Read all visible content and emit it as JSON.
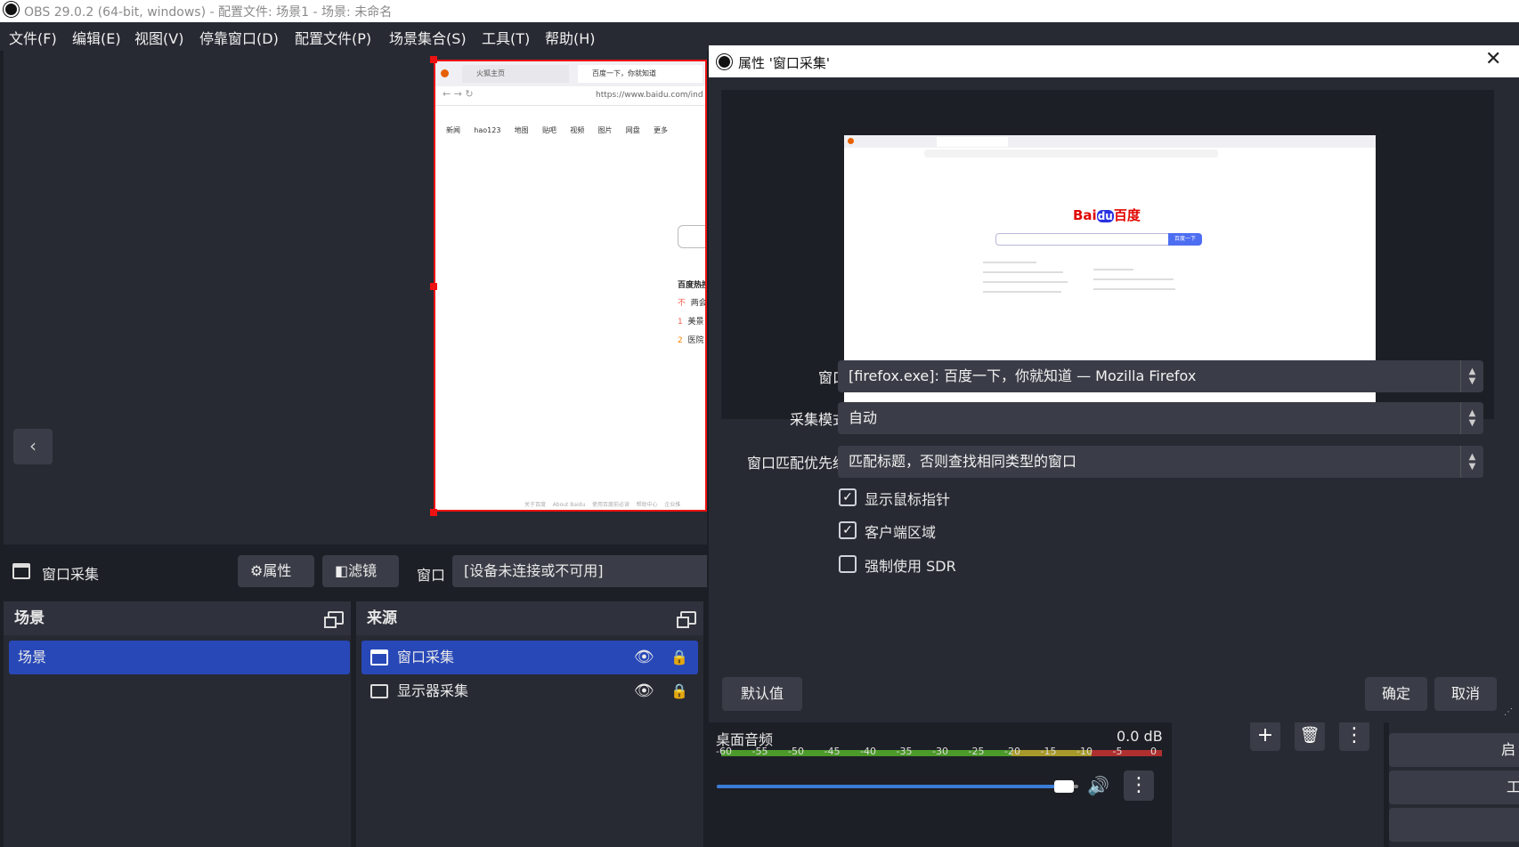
{
  "titlebar": {
    "title": "OBS 29.0.2 (64-bit, windows) - 配置文件: 场景1 - 场景: 未命名"
  },
  "menu": [
    "文件(F)",
    "编辑(E)",
    "视图(V)",
    "停靠窗口(D)",
    "配置文件(P)",
    "场景集合(S)",
    "工具(T)",
    "帮助(H)"
  ],
  "preview_browser": {
    "tab1": "火狐主页",
    "tab2": "百度一下，你就知道",
    "url": "https://www.baidu.com/ind",
    "nav_links": [
      "新闻",
      "hao123",
      "地图",
      "贴吧",
      "视频",
      "图片",
      "网盘",
      "更多"
    ],
    "hot_title": "百度热搜",
    "hot_items": [
      {
        "rank": "不",
        "text": "两会"
      },
      {
        "rank": "1",
        "text": "美景"
      },
      {
        "rank": "2",
        "text": "医院"
      }
    ],
    "footer": [
      "关于百度",
      "About Baidu",
      "使用百度前必读",
      "帮助中心",
      "企业推"
    ]
  },
  "source_toolbar": {
    "source_name": "窗口采集",
    "properties_label": "属性",
    "filters_label": "滤镜",
    "window_label": "窗口",
    "window_value": "[设备未连接或不可用]"
  },
  "scenes": {
    "title": "场景",
    "items": [
      "场景"
    ]
  },
  "sources": {
    "title": "来源",
    "items": [
      "窗口采集",
      "显示器采集"
    ]
  },
  "dialog": {
    "title": "属性 '窗口采集'",
    "baidu": {
      "logo_bai": "Bai",
      "logo_du": "du",
      "logo_cn": "百度",
      "search_btn": "百度一下"
    },
    "fields": {
      "window_label": "窗口",
      "window_value": "[firefox.exe]: 百度一下，你就知道 — Mozilla Firefox",
      "capture_label": "采集模式",
      "capture_value": "自动",
      "priority_label": "窗口匹配优先级",
      "priority_value": "匹配标题，否则查找相同类型的窗口"
    },
    "checkboxes": [
      {
        "label": "显示鼠标指针",
        "checked": true
      },
      {
        "label": "客户端区域",
        "checked": true
      },
      {
        "label": "强制使用 SDR",
        "checked": false
      }
    ],
    "defaults_btn": "默认值",
    "ok_btn": "确定",
    "cancel_btn": "取消"
  },
  "mixer": {
    "channel": "桌面音频",
    "db": "0.0 dB",
    "scale": [
      "-60",
      "-55",
      "-50",
      "-45",
      "-40",
      "-35",
      "-30",
      "-25",
      "-20",
      "-15",
      "-10",
      "-5",
      "0"
    ],
    "volume_fraction": 0.96
  },
  "controls": {
    "start_virtual": "启动虚",
    "tools": "工"
  },
  "colors": {
    "accent": "#2848b8",
    "selection": "#e11111",
    "meter_green": "#4c9a2a",
    "meter_yellow": "#a89a2a",
    "meter_red": "#b03030",
    "slider": "#3a7bd5"
  }
}
